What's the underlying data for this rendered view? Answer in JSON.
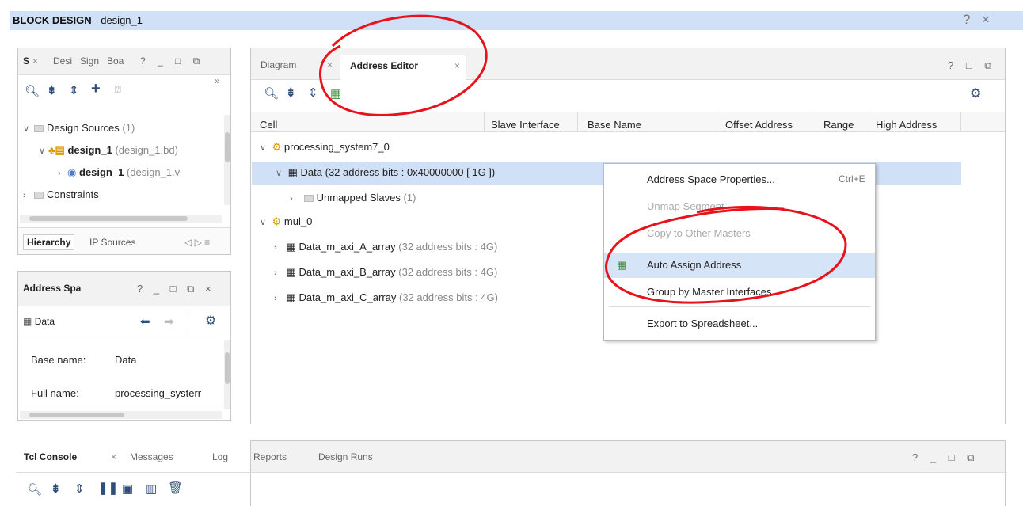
{
  "banner": {
    "title_bold": "BLOCK DESIGN",
    "title_rest": " - design_1",
    "help": "?",
    "close": "×"
  },
  "sources": {
    "tabs": [
      "S",
      "×",
      "Desi",
      "Sign",
      "Boa"
    ],
    "controls": "? _ □ ⧉",
    "overflow": "»",
    "tree": [
      {
        "label": "Design Sources",
        "suffix": "(1)"
      },
      {
        "label": "design_1",
        "suffix": "(design_1.bd)"
      },
      {
        "label": "design_1",
        "suffix": "(design_1.v"
      },
      {
        "label": "Constraints",
        "suffix": ""
      }
    ],
    "bottom_tabs": [
      "Hierarchy",
      "IP Sources"
    ],
    "bottom_ctrl": "◁ ▷ ≡"
  },
  "address_space": {
    "title": "Address Spa",
    "controls": "? _ □ ⧉ ×",
    "item": "Data",
    "fields": [
      {
        "label": "Base name:",
        "value": "Data"
      },
      {
        "label": "Full name:",
        "value": "processing_systerr"
      }
    ]
  },
  "editor": {
    "tabs": [
      "Diagram",
      "Address Editor"
    ],
    "tab_close": "×",
    "controls": "? □ ⧉",
    "columns": [
      "Cell",
      "Slave Interface",
      "Base Name",
      "Offset Address",
      "Range",
      "High Address"
    ],
    "rows": [
      {
        "label": "processing_system7_0",
        "dim": ""
      },
      {
        "label": "Data (32 address bits : 0x40000000 [ 1G ])",
        "dim": ""
      },
      {
        "label": "Unmapped Slaves",
        "dim": " (1)"
      },
      {
        "label": "mul_0",
        "dim": ""
      },
      {
        "label": "Data_m_axi_A_array",
        "dim": " (32 address bits : 4G)"
      },
      {
        "label": "Data_m_axi_B_array",
        "dim": " (32 address bits : 4G)"
      },
      {
        "label": "Data_m_axi_C_array",
        "dim": " (32 address bits : 4G)"
      }
    ]
  },
  "context_menu": {
    "items": [
      {
        "label": "Address Space Properties...",
        "shortcut": "Ctrl+E",
        "disabled": false
      },
      {
        "label": "Unmap Segment",
        "shortcut": "",
        "disabled": true
      },
      {
        "label": "Copy to Other Masters",
        "shortcut": "",
        "disabled": true
      },
      {
        "label": "Auto Assign Address",
        "shortcut": "",
        "disabled": false
      },
      {
        "label": "Group by Master Interfaces",
        "shortcut": "",
        "disabled": false
      },
      {
        "label": "Export to Spreadsheet...",
        "shortcut": "",
        "disabled": false
      }
    ]
  },
  "console": {
    "tabs": [
      "Tcl Console",
      "Messages",
      "Log",
      "Reports",
      "Design Runs"
    ],
    "tab_close": "×",
    "controls": "? _ □ ⧉"
  },
  "colors": {
    "selected_row": "#cfe0f7",
    "menu_highlight": "#d6e4f7",
    "annotation": "#e8121b",
    "banner": "#cfe0f7"
  }
}
